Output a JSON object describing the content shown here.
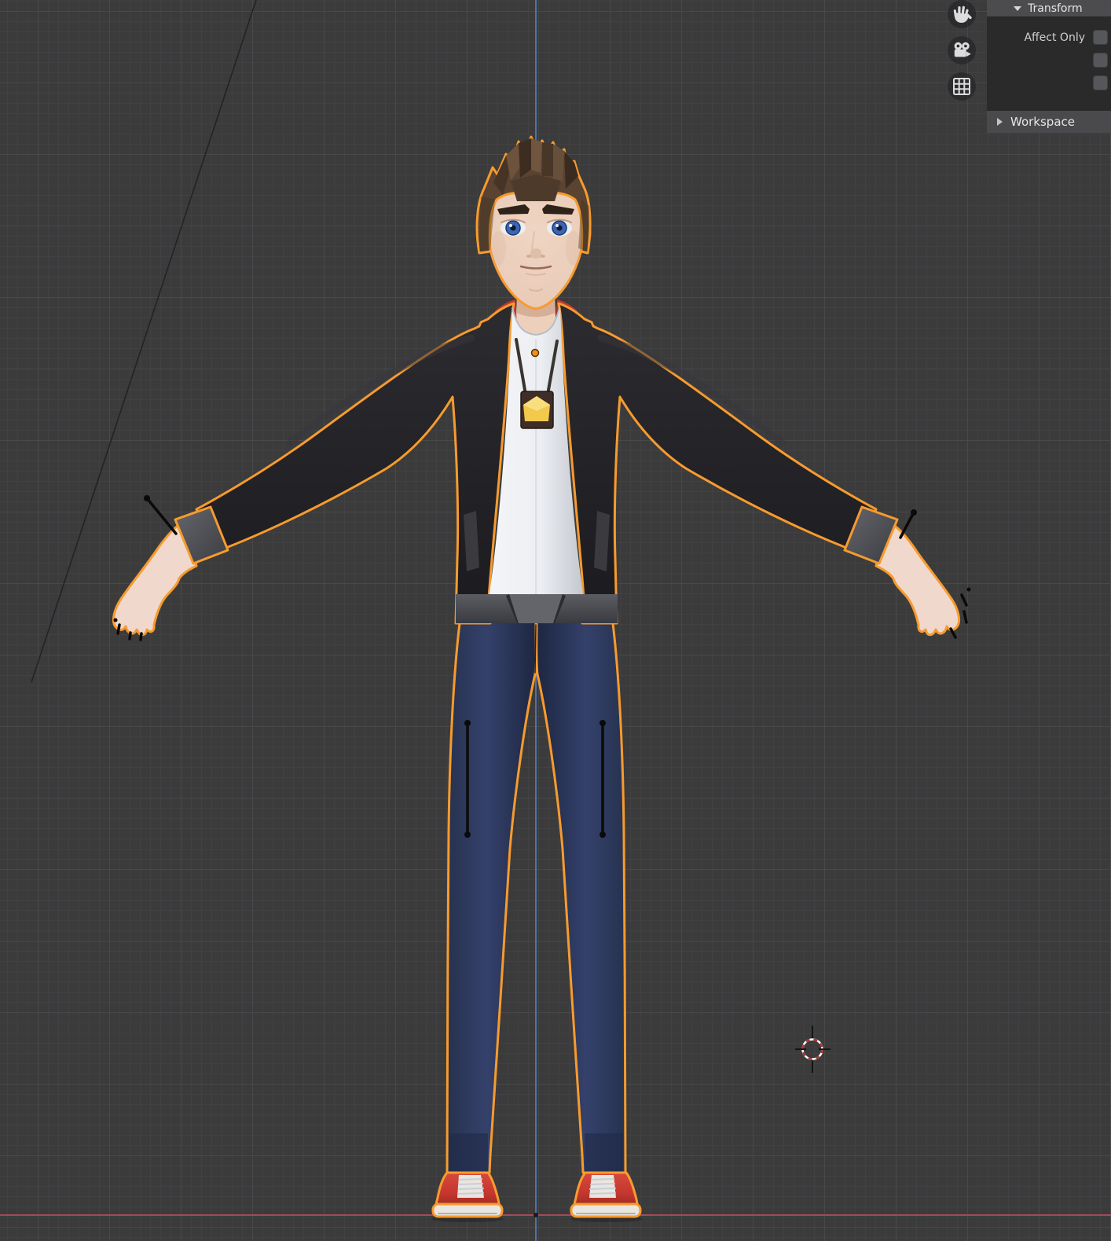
{
  "app": "blender-3d-viewport",
  "sidebar": {
    "transform": {
      "title": "Transform",
      "expanded": true,
      "affect_only_label": "Affect Only",
      "checkbox_count": 3
    },
    "workspace": {
      "title": "Workspace",
      "expanded": false
    }
  },
  "nav_gizmos": [
    {
      "icon": "hand-icon",
      "meaning": "pan view"
    },
    {
      "icon": "camera-icon",
      "meaning": "camera view"
    },
    {
      "icon": "grid-icon",
      "meaning": "toggle orthographic view"
    }
  ],
  "viewport": {
    "selected_object_outline": "orange",
    "cursor": "3d-cursor",
    "axis_lines": [
      "x-axis-red-horizontal",
      "z-axis-blue-vertical"
    ]
  },
  "colors": {
    "vp_bg": "#3b3b3c",
    "grid_minor": "#414143",
    "grid_major": "#49494b",
    "axis_x": "#a54959",
    "axis_z": "#4d74a8",
    "outline": "#f79b2e",
    "panel_header_bg": "#4c4c4e",
    "panel_body_bg": "#2a2a2b",
    "panel_text": "#e5e5e5",
    "panel_label": "#cfd0d1",
    "checkbox_bg": "#55575a",
    "gizmo_glyph": "#dcdcde",
    "hair_base": "#5a4330",
    "skin": "#ecd0bc",
    "iris": "#3a66b5",
    "collar_red": "#c23a32",
    "jacket": "#232226",
    "cuff": "#5d5e63",
    "hem": "#55565b",
    "shirt": "#eef0f4",
    "pendant": "#3f2e27",
    "badge_yellow": "#f2c94d",
    "origin_dot": "#ef8f1c",
    "jeans": "#2e3c63",
    "shoe_red": "#c5372e",
    "sole": "#eae6df",
    "cursor_red": "#b13434",
    "cursor_white": "#ffffff",
    "stick_black": "#0a0a0a"
  }
}
